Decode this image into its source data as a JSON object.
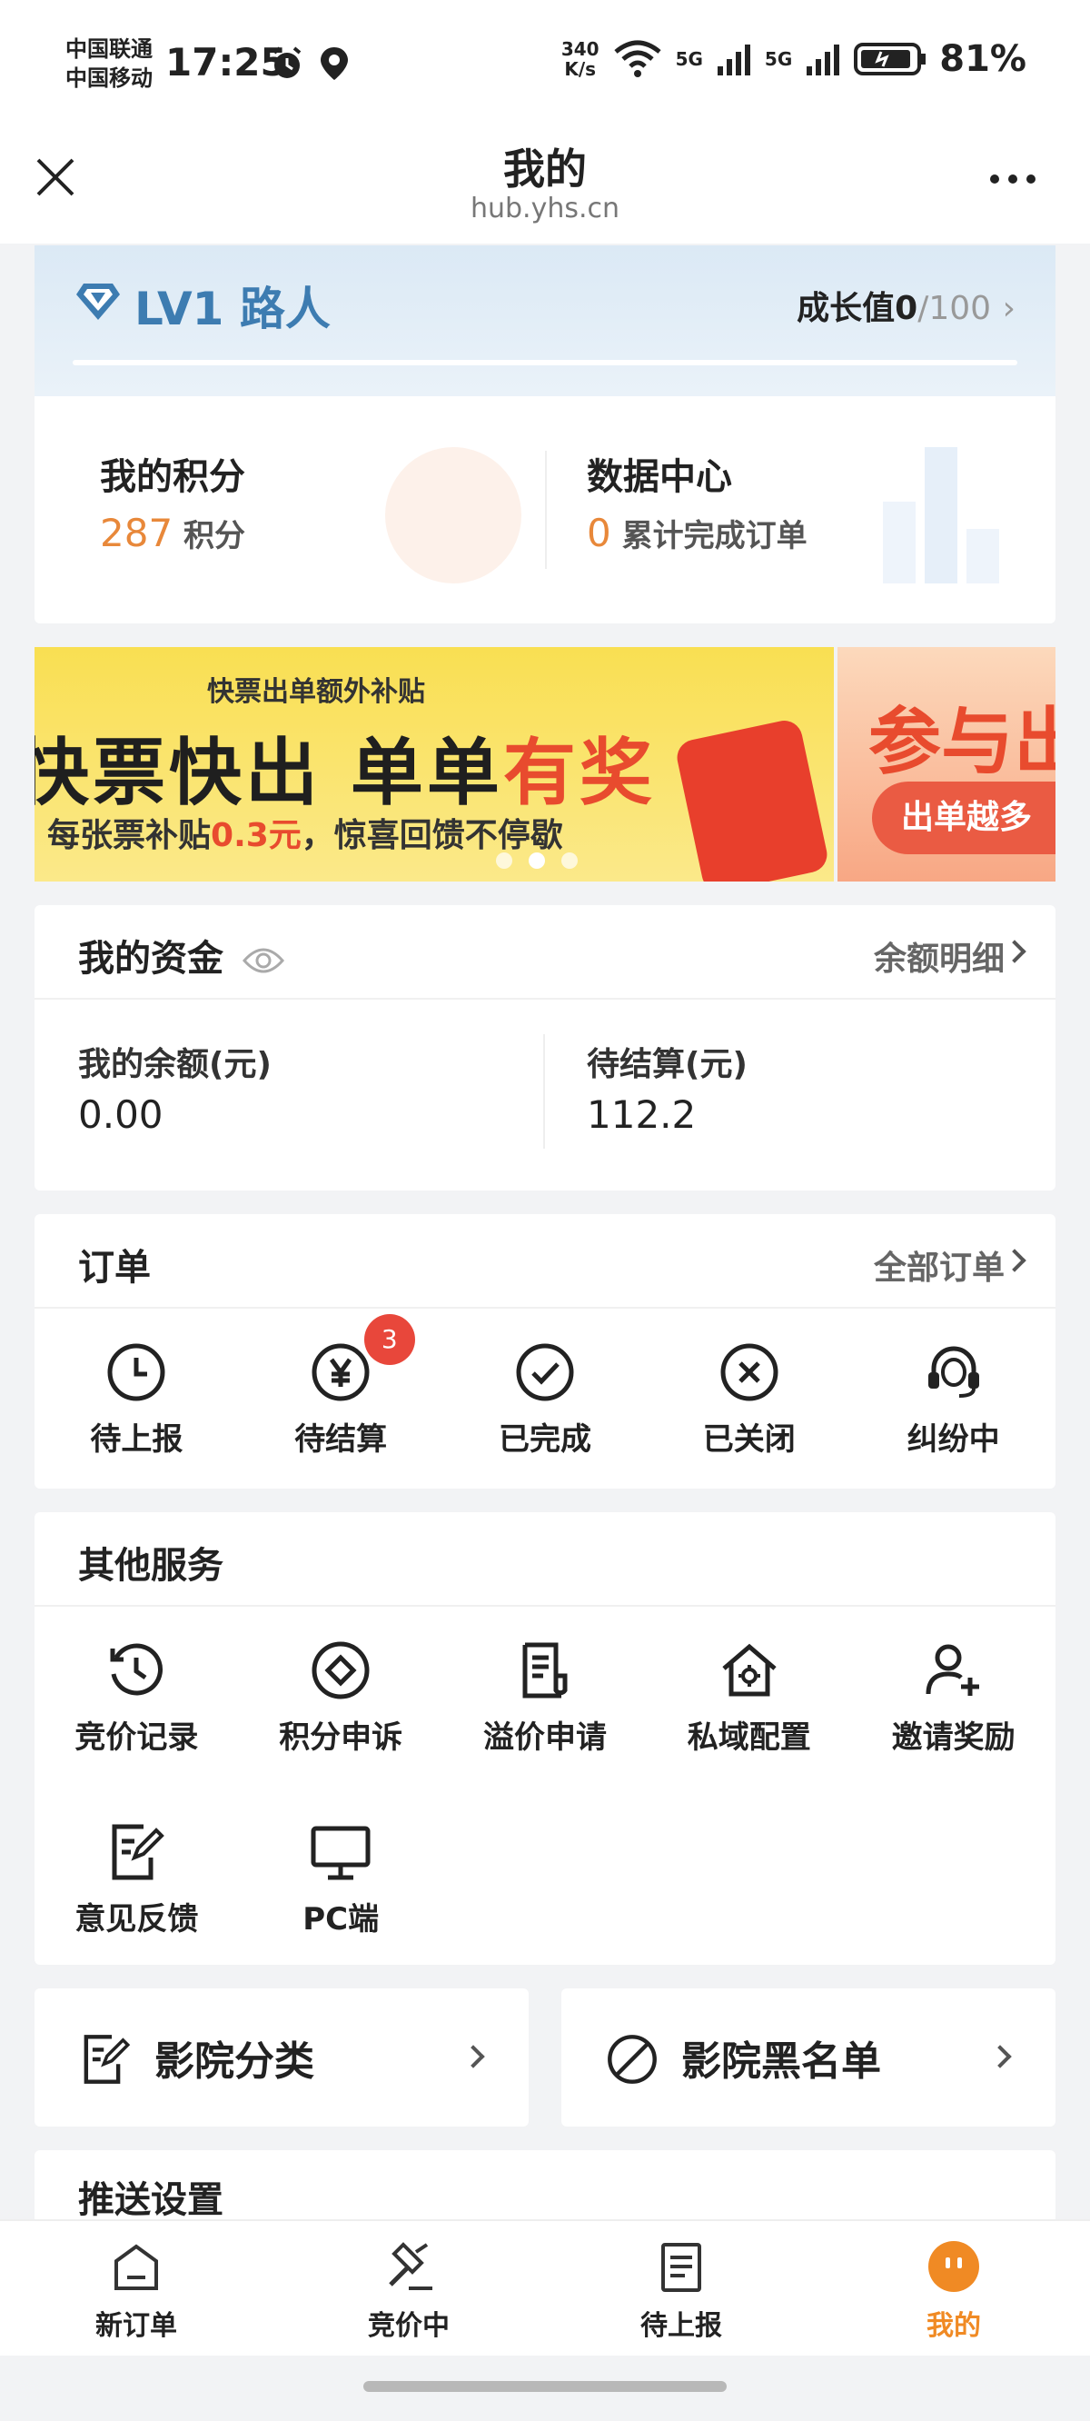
{
  "status_bar": {
    "carrier_1": "中国联通",
    "carrier_2": "中国移动",
    "time": "17:25",
    "net_speed_value": "340",
    "net_speed_unit": "K/s",
    "signal_1": "5G",
    "signal_2": "5G",
    "battery": "81%",
    "icons": [
      "alarm-icon",
      "location-icon",
      "wifi-icon",
      "signal-icon",
      "battery-icon"
    ]
  },
  "nav": {
    "title": "我的",
    "url": "hub.yhs.cn"
  },
  "level": {
    "name": "LV1 路人",
    "growth_label": "成长值",
    "growth_current": "0",
    "growth_max": "/100"
  },
  "points": {
    "title": "我的积分",
    "value": "287",
    "unit": "积分"
  },
  "data_center": {
    "title": "数据中心",
    "value": "0",
    "unit": "累计完成订单"
  },
  "banner": {
    "subtitle": "快票出单额外补贴",
    "main_black": "快票快出 单单",
    "main_red": "有奖",
    "desc_prefix": "每张票补贴",
    "desc_amount": "0.3元",
    "desc_suffix": "，惊喜回馈不停歇",
    "next_title": "参与出",
    "next_button": "出单越多"
  },
  "funds": {
    "title": "我的资金",
    "detail_link": "余额明细",
    "balance_label": "我的余额(元)",
    "balance_value": "0.00",
    "pending_label": "待结算(元)",
    "pending_value": "112.2"
  },
  "orders": {
    "title": "订单",
    "all_link": "全部订单",
    "items": [
      {
        "label": "待上报",
        "icon": "clock-icon"
      },
      {
        "label": "待结算",
        "icon": "yen-icon",
        "badge": "3"
      },
      {
        "label": "已完成",
        "icon": "check-circle-icon"
      },
      {
        "label": "已关闭",
        "icon": "x-circle-icon"
      },
      {
        "label": "纠纷中",
        "icon": "headset-icon"
      }
    ]
  },
  "services": {
    "title": "其他服务",
    "items": [
      {
        "label": "竞价记录",
        "icon": "history-icon"
      },
      {
        "label": "积分申诉",
        "icon": "diamond-icon"
      },
      {
        "label": "溢价申请",
        "icon": "receipt-icon"
      },
      {
        "label": "私域配置",
        "icon": "home-gear-icon"
      },
      {
        "label": "邀请奖励",
        "icon": "add-user-icon"
      },
      {
        "label": "意见反馈",
        "icon": "edit-doc-icon"
      },
      {
        "label": "PC端",
        "icon": "monitor-icon"
      }
    ]
  },
  "cinema": {
    "category_label": "影院分类",
    "blacklist_label": "影院黑名单"
  },
  "push": {
    "title": "推送设置"
  },
  "tabs": [
    {
      "label": "新订单",
      "icon": "home-icon"
    },
    {
      "label": "竞价中",
      "icon": "gavel-icon"
    },
    {
      "label": "待上报",
      "icon": "document-icon"
    },
    {
      "label": "我的",
      "icon": "profile-icon",
      "active": true
    }
  ],
  "colors": {
    "accent_orange": "#f08a24",
    "points_orange": "#e8883a",
    "badge_red": "#e8473b",
    "level_blue": "#3d7cb1"
  }
}
